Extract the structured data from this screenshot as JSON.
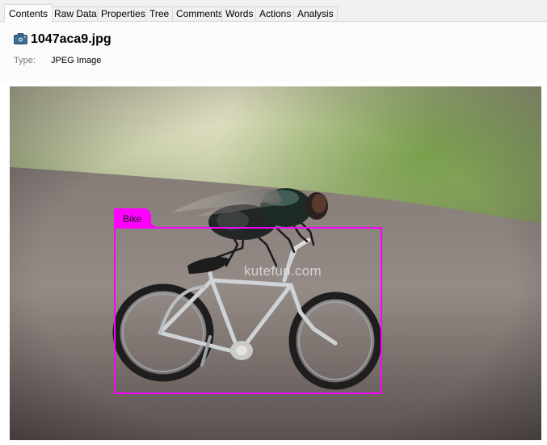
{
  "tabs": [
    {
      "label": "Contents",
      "active": true
    },
    {
      "label": "Raw Data",
      "active": false
    },
    {
      "label": "Properties",
      "active": false
    },
    {
      "label": "Tree",
      "active": false
    },
    {
      "label": "Comments",
      "active": false
    },
    {
      "label": "Words",
      "active": false
    },
    {
      "label": "Actions",
      "active": false
    },
    {
      "label": "Analysis",
      "active": false
    }
  ],
  "file": {
    "icon": "camera-icon",
    "name": "1047aca9.jpg",
    "type_label": "Type:",
    "type_value": "JPEG Image"
  },
  "image": {
    "watermark": "kutefun.com",
    "detection": {
      "label": "Bike",
      "color": "#ff00ff"
    }
  },
  "colors": {
    "accent": "#ff00ff",
    "tab_background": "#f0f0f0",
    "header_background": "#fbfbfb"
  }
}
